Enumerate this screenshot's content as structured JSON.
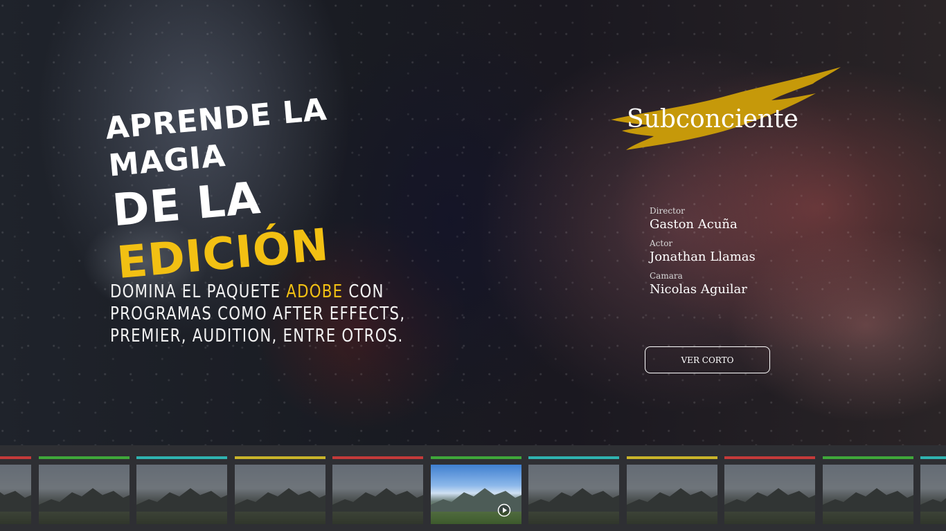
{
  "hero": {
    "title_line1": "Aprende la magia",
    "title_line2_prefix": "de la ",
    "title_line2_accent": "edición",
    "subtitle_part1": "Domina el paquete ",
    "subtitle_accent": "Adobe",
    "subtitle_part2": " con programas como After Effects, Premier, Audition, entre otros."
  },
  "feature": {
    "title": "Subconciente",
    "credits": [
      {
        "role": "Director",
        "name": "Gaston Acuña"
      },
      {
        "role": "Actor",
        "name": "Jonathan Llamas"
      },
      {
        "role": "Camara",
        "name": "Nicolas Aguilar"
      }
    ],
    "button_label": "VER CORTO"
  },
  "colors": {
    "accent": "#f2c013",
    "bar_red": "#c43a3a",
    "bar_green": "#3fa83a",
    "bar_teal": "#2fb3b0",
    "bar_yellow": "#c9b42a"
  },
  "filmstrip": {
    "thumbnails": [
      {
        "bar": "red",
        "active": false,
        "icon": "landscape-thumbnail"
      },
      {
        "bar": "green",
        "active": false,
        "icon": "landscape-thumbnail"
      },
      {
        "bar": "teal",
        "active": false,
        "icon": "landscape-thumbnail"
      },
      {
        "bar": "yellow",
        "active": false,
        "icon": "landscape-thumbnail"
      },
      {
        "bar": "red",
        "active": false,
        "icon": "landscape-thumbnail"
      },
      {
        "bar": "green",
        "active": true,
        "icon": "play-icon"
      },
      {
        "bar": "teal",
        "active": false,
        "icon": "landscape-thumbnail"
      },
      {
        "bar": "yellow",
        "active": false,
        "icon": "landscape-thumbnail"
      },
      {
        "bar": "red",
        "active": false,
        "icon": "landscape-thumbnail"
      },
      {
        "bar": "green",
        "active": false,
        "icon": "landscape-thumbnail"
      },
      {
        "bar": "teal",
        "active": false,
        "icon": "landscape-thumbnail"
      }
    ]
  }
}
